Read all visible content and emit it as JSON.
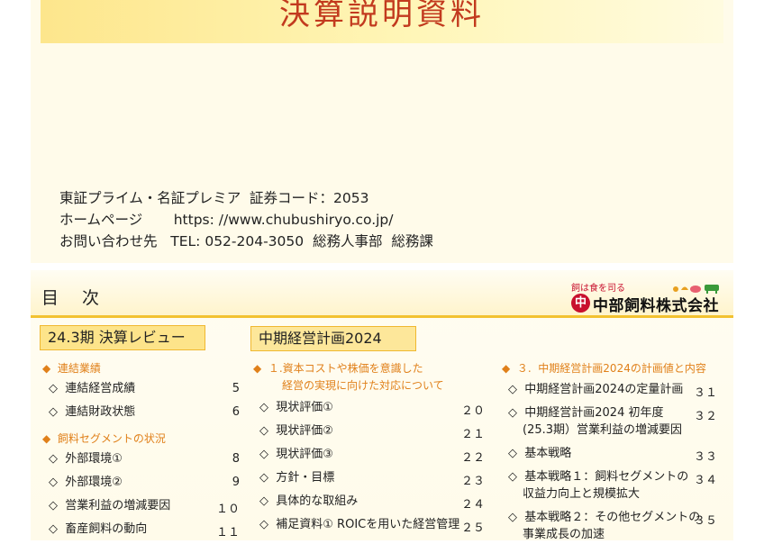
{
  "cover": {
    "title": "決算説明資料",
    "contact": [
      "東証プライム・名証プレミア  証券コード：2053",
      "ホームページ       https: //www.chubushiryo.co.jp/",
      "お問い合わせ先   TEL: 052-204-3050  総務人事部  総務課"
    ]
  },
  "toc": {
    "title": "目 次",
    "logo": {
      "tagline": "飼は食を司る",
      "mark": "中",
      "name": "中部飼料株式会社"
    },
    "col1": {
      "section": "24.3期 決算レビュー",
      "cat1": "◆  連結業績",
      "cat2": "◆  飼料セグメントの状況",
      "items": [
        {
          "label": "◇  連結経営成績",
          "page": "5"
        },
        {
          "label": "◇  連結財政状態",
          "page": "6"
        },
        {
          "label": "◇  外部環境①",
          "page": "8"
        },
        {
          "label": "◇  外部環境②",
          "page": "9"
        },
        {
          "label": "◇  営業利益の増減要因",
          "page": "１０"
        },
        {
          "label": "◇  畜産飼料の動向",
          "page": "１１"
        }
      ]
    },
    "col2": {
      "section": "中期経営計画2024",
      "cat1": "◆  １.資本コストや株価を意識した",
      "cat1b": "経営の実現に向けた対応について",
      "items": [
        {
          "label": "◇  現状評価①",
          "page": "２０"
        },
        {
          "label": "◇  現状評価②",
          "page": "２１"
        },
        {
          "label": "◇  現状評価③",
          "page": "２２"
        },
        {
          "label": "◇  方針・目標",
          "page": "２３"
        },
        {
          "label": "◇  具体的な取組み",
          "page": "２４"
        },
        {
          "label": "◇  補足資料① ROICを用いた経営管理",
          "page": "２５"
        }
      ]
    },
    "col3": {
      "cat1": "◆  ３.  中期経営計画2024の計画値と内容",
      "items": [
        {
          "label": "◇  中期経営計画2024の定量計画",
          "page": "３１"
        },
        {
          "label": "◇  中期経営計画2024 初年度",
          "label2": "(25.3期）営業利益の増減要因",
          "page": "３２"
        },
        {
          "label": "◇  基本戦略",
          "page": "３３"
        },
        {
          "label": "◇  基本戦略１：飼料セグメントの",
          "label2": "収益力向上と規模拡大",
          "page": "３４"
        },
        {
          "label": "◇  基本戦略２：その他セグメントの",
          "label2": "事業成長の加速",
          "page": "３５"
        }
      ]
    }
  },
  "colors": {
    "accent": "#f2c230",
    "title_red": "#c23a1e",
    "category_orange": "#e0801a",
    "brand_red": "#c8102e"
  }
}
